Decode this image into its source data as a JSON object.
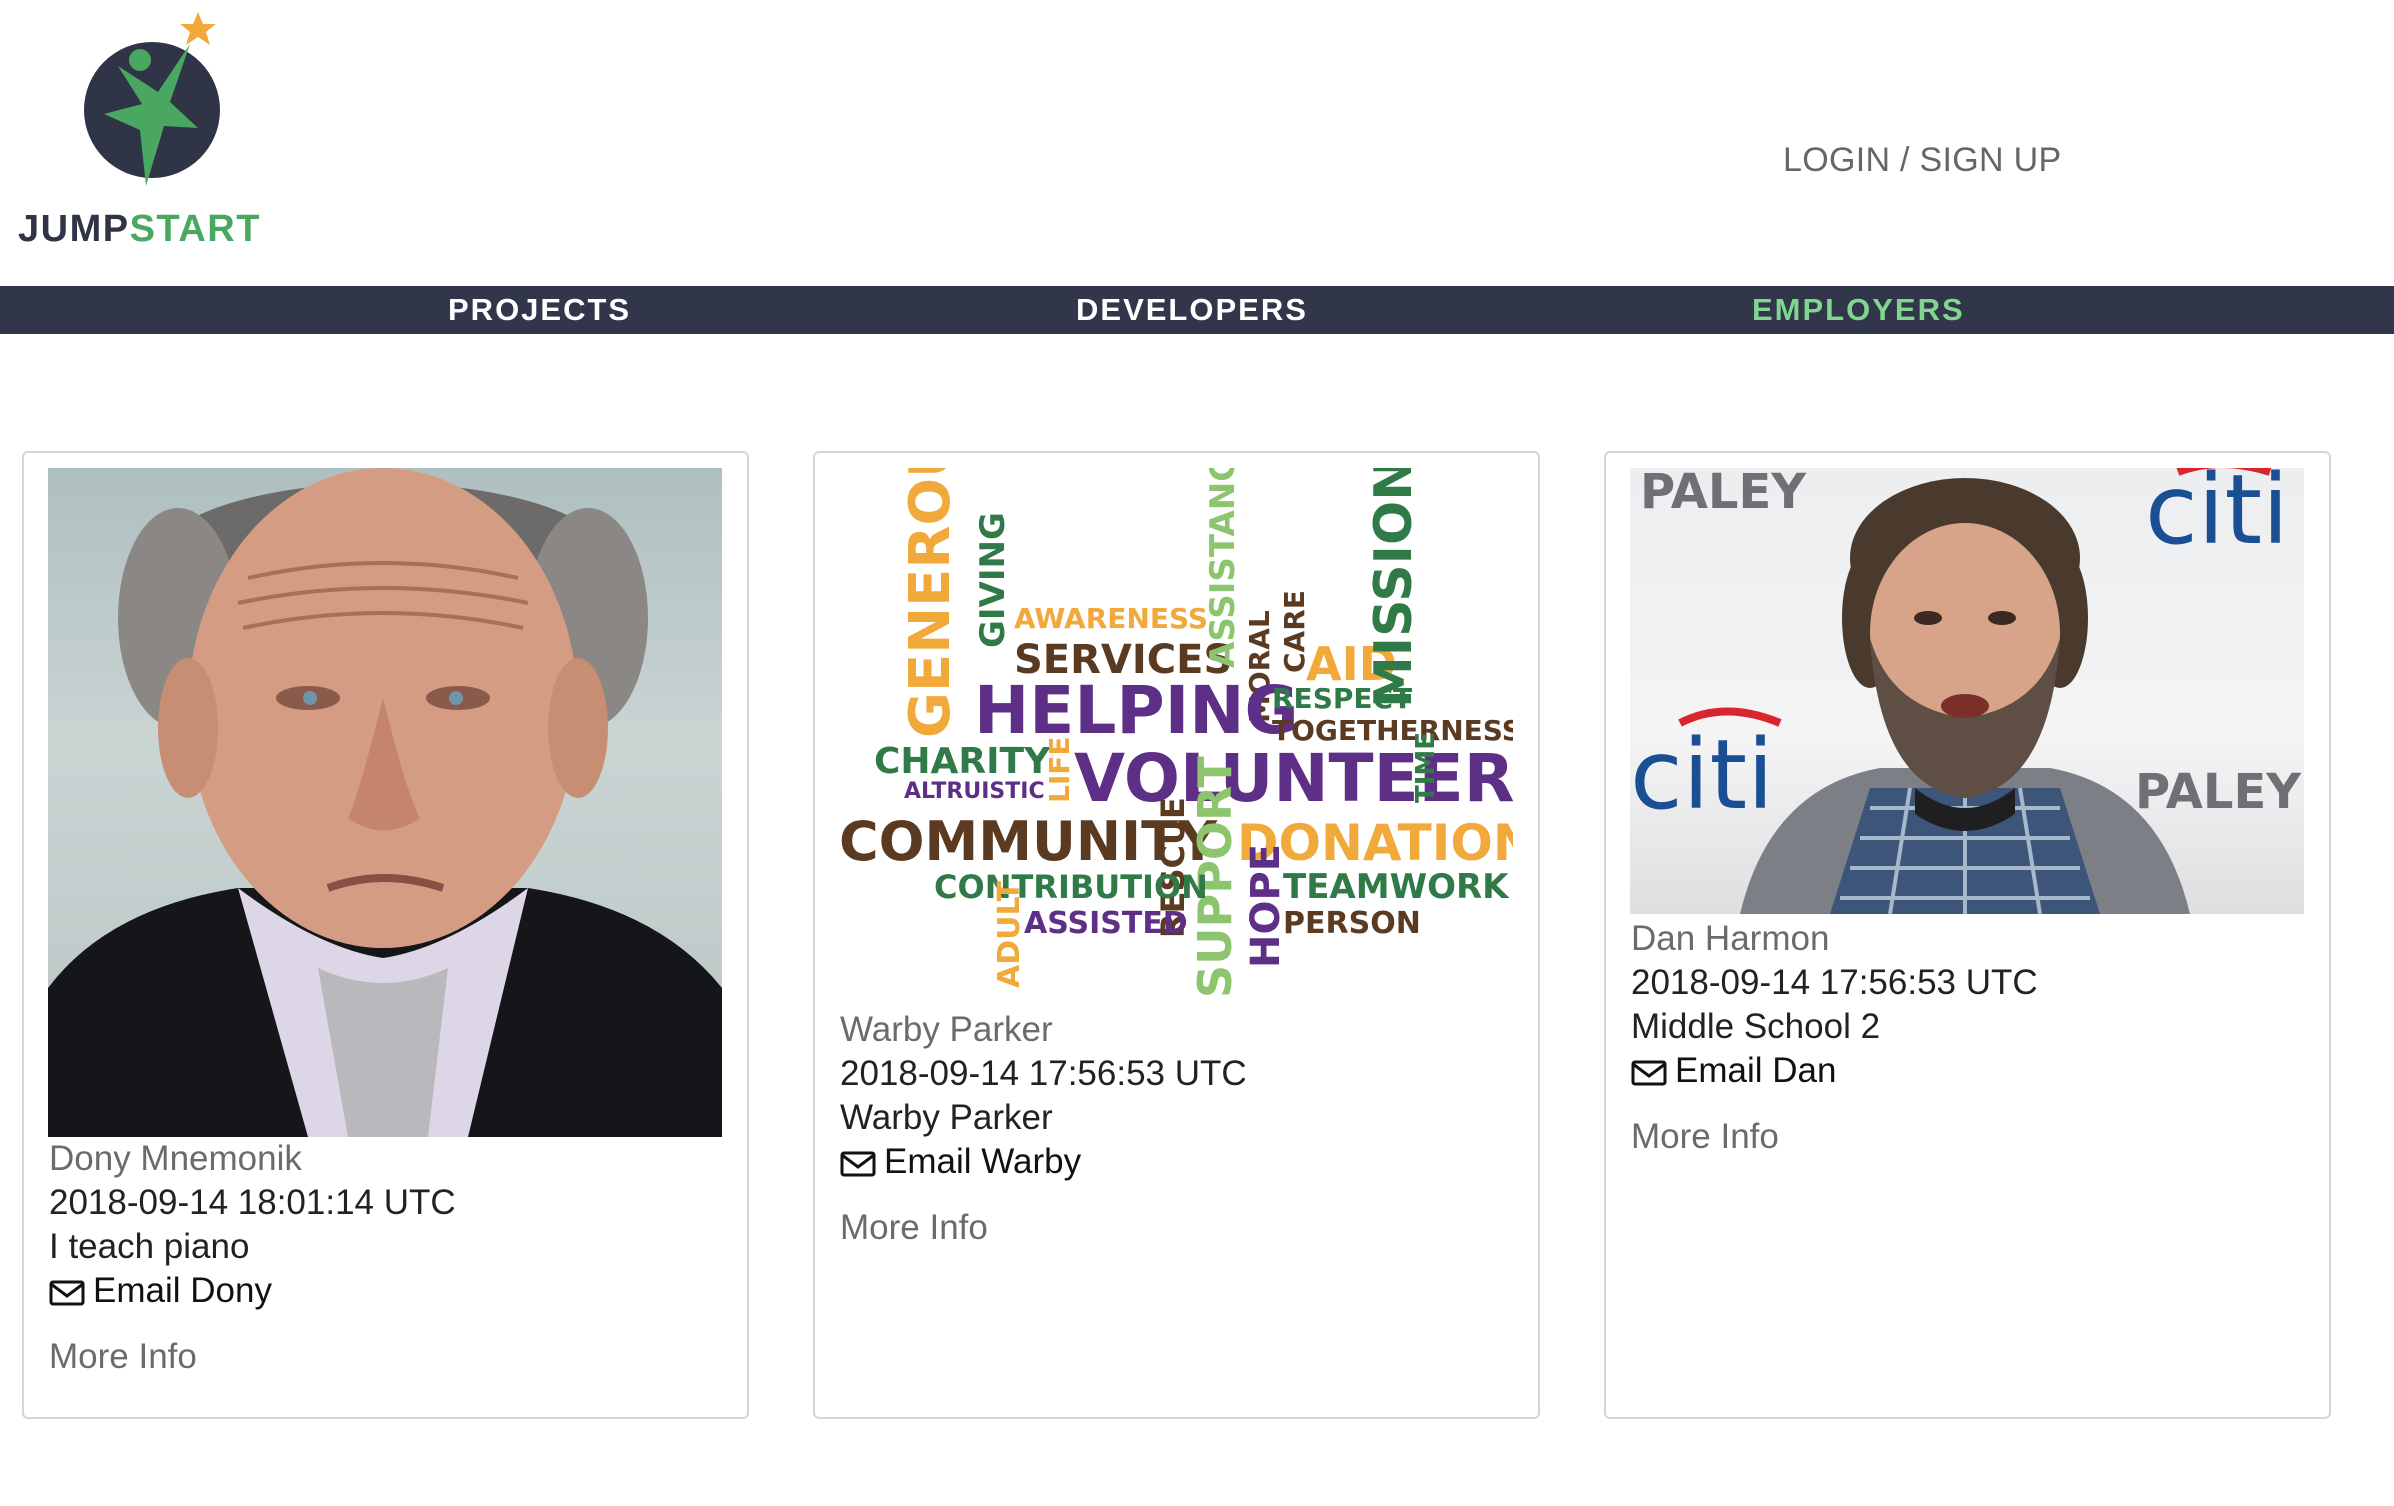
{
  "brand": {
    "name_part1": "JUMP",
    "name_part2": "START",
    "colors": {
      "navy": "#2f3447",
      "green": "#4aa761",
      "star": "#f2a93b"
    }
  },
  "header": {
    "login_label": "LOGIN / SIGN UP"
  },
  "nav": {
    "items": [
      {
        "label": "PROJECTS",
        "active": false
      },
      {
        "label": "DEVELOPERS",
        "active": false
      },
      {
        "label": "EMPLOYERS",
        "active": true
      }
    ],
    "background": "#31364b",
    "active_color": "#7fd68e"
  },
  "cards": [
    {
      "name": "Dony Mnemonik",
      "timestamp": "2018-09-14 18:01:14 UTC",
      "description": "I teach piano",
      "email_label": "Email Dony",
      "more_label": "More Info",
      "image": "portrait-photo"
    },
    {
      "name": "Warby Parker",
      "timestamp": "2018-09-14 17:56:53 UTC",
      "description": "Warby Parker",
      "email_label": "Email Warby",
      "more_label": "More Info",
      "image": "word-cloud-image",
      "wordcloud_words": [
        "GENEROUS",
        "GIVING",
        "AWARENESS",
        "SERVICES",
        "ASSISTANCE",
        "MORAL",
        "CARE",
        "AID",
        "MISSION",
        "HELPING",
        "RESPECT",
        "TOGETHERNESS",
        "CHARITY",
        "ALTRUISTIC",
        "LIFE",
        "VOLUNTEER",
        "TIME",
        "COMMUNITY",
        "RESCUE",
        "SUPPORT",
        "DONATIONS",
        "CONTRIBUTION",
        "HOPE",
        "TEAMWORK",
        "ADULT",
        "ASSISTED",
        "PERSON"
      ]
    },
    {
      "name": "Dan Harmon",
      "timestamp": "2018-09-14 17:56:53 UTC",
      "description": "Middle School 2",
      "email_label": "Email Dan",
      "more_label": "More Info",
      "image": "portrait-photo",
      "backdrop_text": [
        "PALEY",
        "citi",
        "citi",
        "PALEY"
      ]
    }
  ],
  "icons": {
    "email": "envelope-icon",
    "logo": "star-person-logo"
  }
}
